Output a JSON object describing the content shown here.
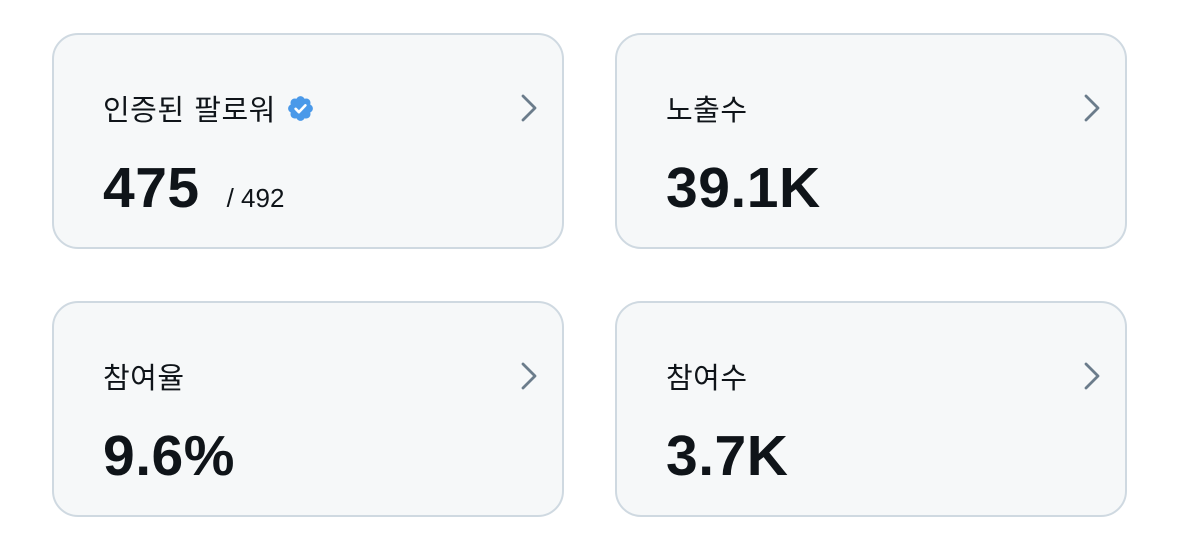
{
  "cards": [
    {
      "label": "인증된 팔로워",
      "value": "475",
      "subvalue": "/ 492",
      "has_verified_badge": true
    },
    {
      "label": "노출수",
      "value": "39.1K"
    },
    {
      "label": "참여율",
      "value": "9.6%"
    },
    {
      "label": "참여수",
      "value": "3.7K"
    }
  ],
  "icons": {
    "verified": "verified-badge-icon",
    "chevron": "chevron-right-icon"
  },
  "colors": {
    "card_background": "#f6f8f9",
    "card_border": "#cfd9e1",
    "text": "#0f1419",
    "chevron": "#6b7c8b",
    "verified_badge": "#4a99e9"
  }
}
